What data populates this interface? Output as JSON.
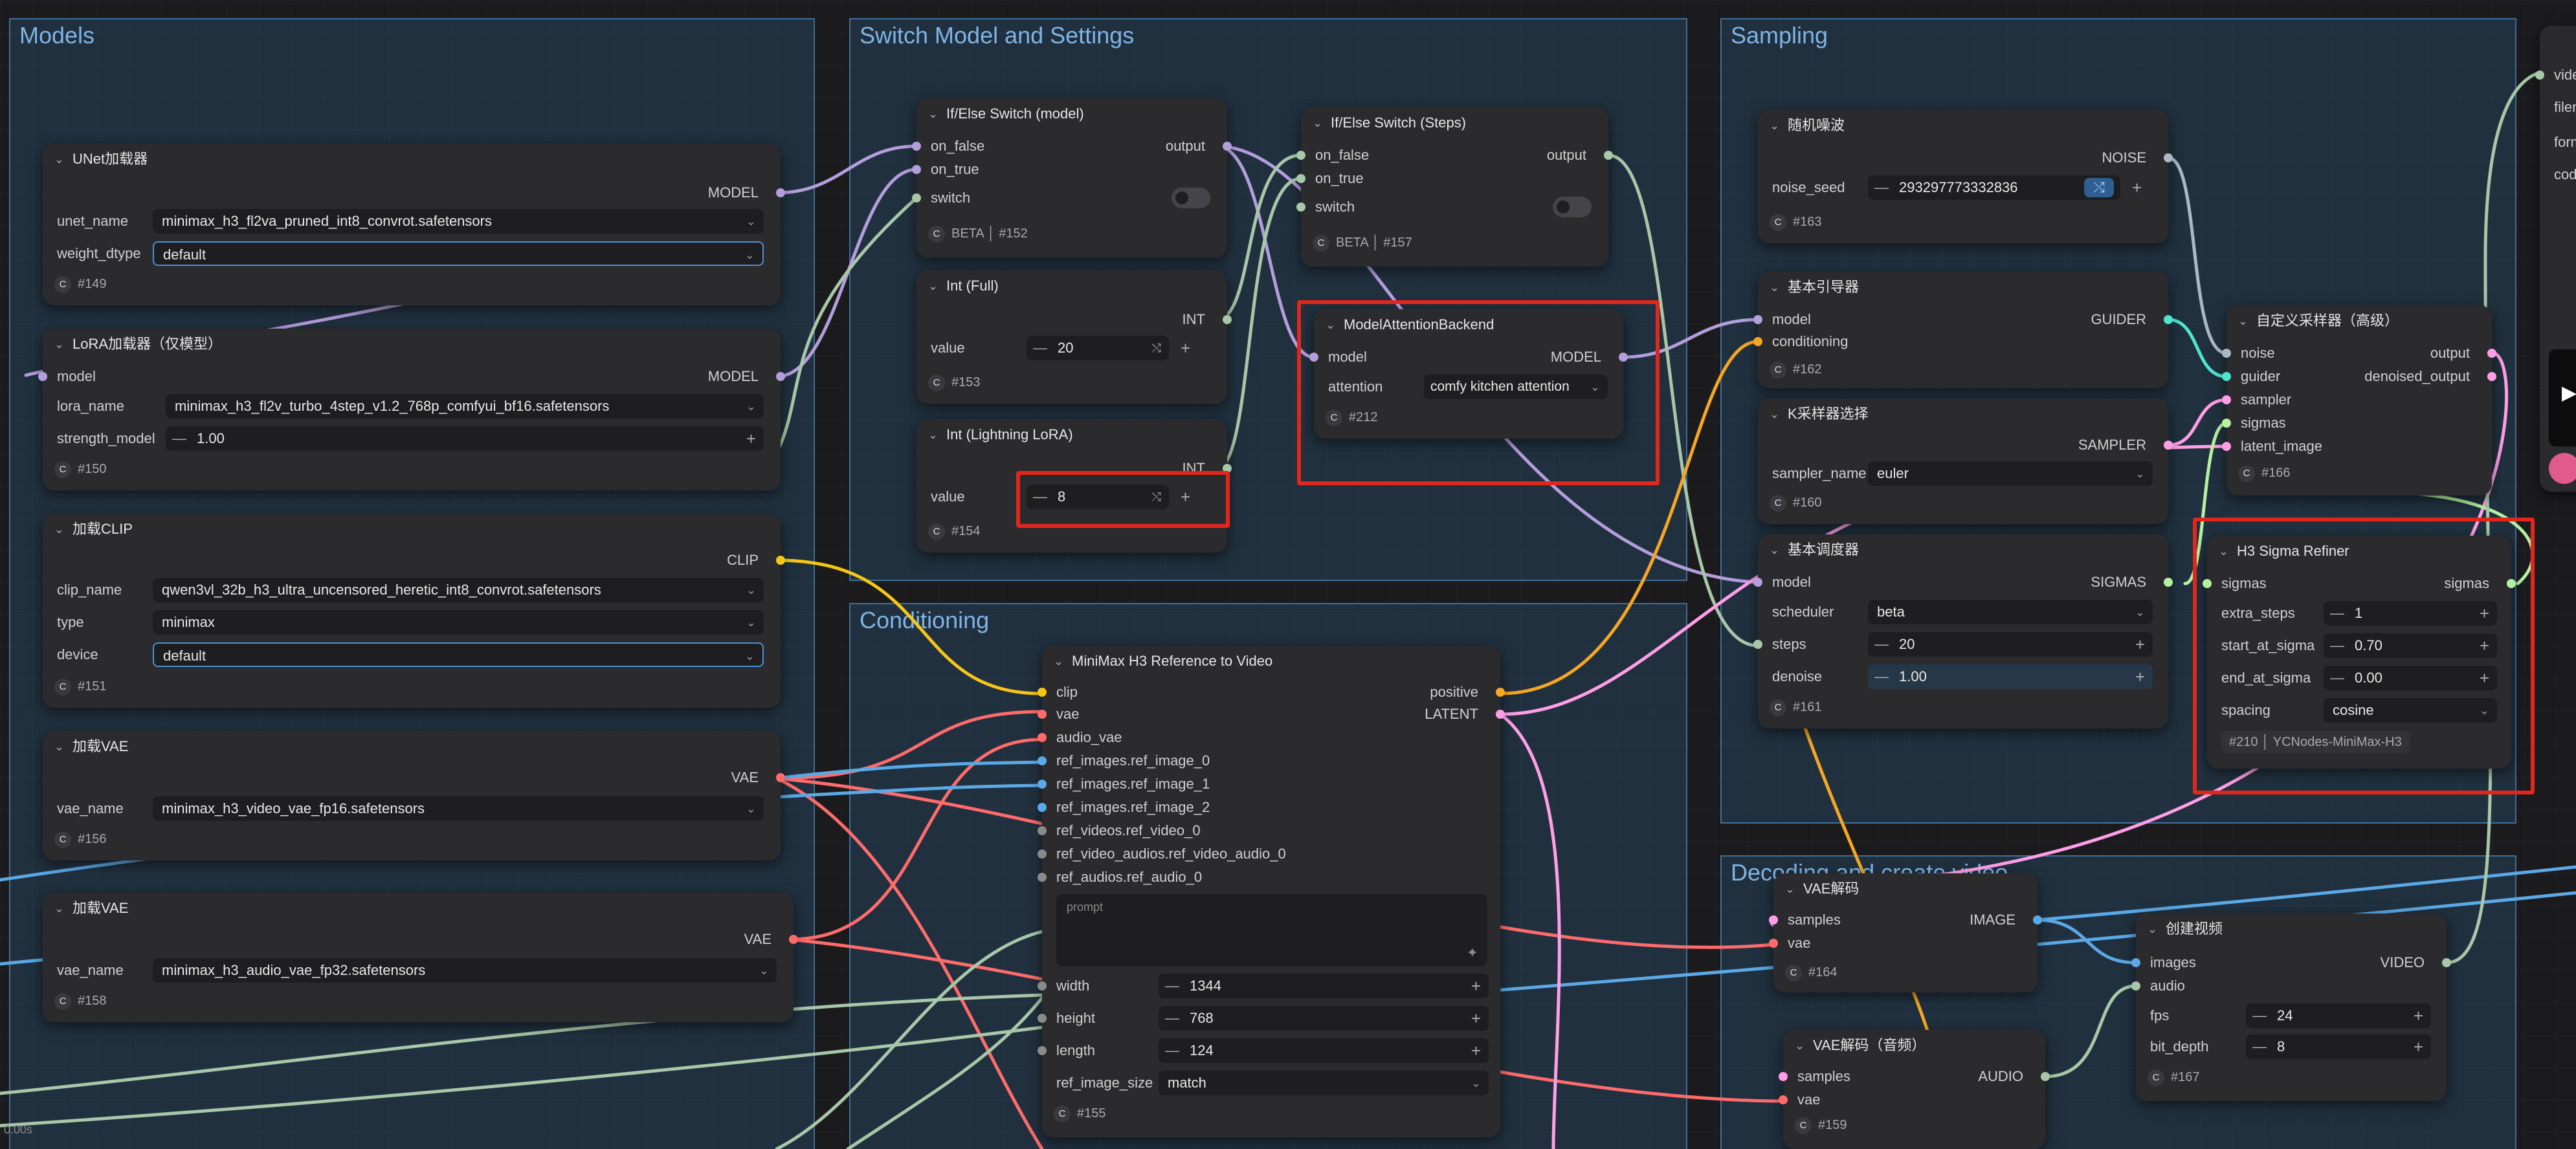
{
  "groups": {
    "models": "Models",
    "switch": "Switch Model and Settings",
    "sampling": "Sampling",
    "conditioning": "Conditioning",
    "decoding": "Decoding and create video"
  },
  "nodes": {
    "unet": {
      "title": "UNet加载器",
      "out": "MODEL",
      "unet_name_label": "unet_name",
      "unet_name": "minimax_h3_fl2va_pruned_int8_convrot.safetensors",
      "weight_dtype_label": "weight_dtype",
      "weight_dtype": "default",
      "id": "#149"
    },
    "lora": {
      "title": "LoRA加载器（仅模型）",
      "in_model": "model",
      "out": "MODEL",
      "lora_name_label": "lora_name",
      "lora_name": "minimax_h3_fl2v_turbo_4step_v1.2_768p_comfyui_bf16.safetensors",
      "strength_label": "strength_model",
      "strength": "1.00",
      "id": "#150"
    },
    "clip": {
      "title": "加载CLIP",
      "out": "CLIP",
      "clip_name_label": "clip_name",
      "clip_name": "qwen3vl_32b_h3_ultra_uncensored_heretic_int8_convrot.safetensors",
      "type_label": "type",
      "type": "minimax",
      "device_label": "device",
      "device": "default",
      "id": "#151"
    },
    "vae1": {
      "title": "加载VAE",
      "out": "VAE",
      "vae_name_label": "vae_name",
      "vae_name": "minimax_h3_video_vae_fp16.safetensors",
      "id": "#156"
    },
    "vae2": {
      "title": "加载VAE",
      "out": "VAE",
      "vae_name_label": "vae_name",
      "vae_name": "minimax_h3_audio_vae_fp32.safetensors",
      "id": "#158"
    },
    "ifelse_model": {
      "title": "If/Else Switch (model)",
      "in1": "on_false",
      "in2": "on_true",
      "in3": "switch",
      "out": "output",
      "badge": "BETA",
      "id": "#152"
    },
    "int_full": {
      "title": "Int (Full)",
      "out": "INT",
      "value_label": "value",
      "value": "20",
      "id": "#153"
    },
    "int_lora": {
      "title": "Int (Lightning LoRA)",
      "out": "INT",
      "value_label": "value",
      "value": "8",
      "id": "#154"
    },
    "ifelse_steps": {
      "title": "If/Else Switch (Steps)",
      "in1": "on_false",
      "in2": "on_true",
      "in3": "switch",
      "out": "output",
      "badge": "BETA",
      "id": "#157"
    },
    "attn": {
      "title": "ModelAttentionBackend",
      "in_model": "model",
      "out": "MODEL",
      "attention_label": "attention",
      "attention": "comfy kitchen attention",
      "id": "#212"
    },
    "ref2video": {
      "title": "MiniMax H3 Reference to Video",
      "inputs": [
        "clip",
        "vae",
        "audio_vae",
        "ref_images.ref_image_0",
        "ref_images.ref_image_1",
        "ref_images.ref_image_2",
        "ref_videos.ref_video_0",
        "ref_video_audios.ref_video_audio_0",
        "ref_audios.ref_audio_0"
      ],
      "out1": "positive",
      "out2": "LATENT",
      "prompt_placeholder": "prompt",
      "width_label": "width",
      "width": "1344",
      "height_label": "height",
      "height": "768",
      "length_label": "length",
      "length": "124",
      "ref_size_label": "ref_image_size",
      "ref_size": "match",
      "id": "#155"
    },
    "noise": {
      "title": "随机噪波",
      "out": "NOISE",
      "seed_label": "noise_seed",
      "seed": "293297773332836",
      "id": "#163"
    },
    "guider": {
      "title": "基本引导器",
      "in1": "model",
      "in2": "conditioning",
      "out": "GUIDER",
      "id": "#162"
    },
    "ksampler_select": {
      "title": "K采样器选择",
      "out": "SAMPLER",
      "sampler_label": "sampler_name",
      "sampler": "euler",
      "id": "#160"
    },
    "scheduler": {
      "title": "基本调度器",
      "in_model": "model",
      "out": "SIGMAS",
      "scheduler_label": "scheduler",
      "scheduler": "beta",
      "steps_label": "steps",
      "steps": "20",
      "denoise_label": "denoise",
      "denoise": "1.00",
      "id": "#161"
    },
    "custom_sampler": {
      "title": "自定义采样器（高级）",
      "inputs": [
        "noise",
        "guider",
        "sampler",
        "sigmas",
        "latent_image"
      ],
      "out1": "output",
      "out2": "denoised_output",
      "id": "#166"
    },
    "refiner": {
      "title": "H3 Sigma Refiner",
      "in": "sigmas",
      "out": "sigmas",
      "extra_label": "extra_steps",
      "extra": "1",
      "start_label": "start_at_sigma",
      "start": "0.70",
      "end_label": "end_at_sigma",
      "end": "0.00",
      "spacing_label": "spacing",
      "spacing": "cosine",
      "id": "#210",
      "pack": "YCNodes-MiniMax-H3"
    },
    "vae_decode": {
      "title": "VAE解码",
      "in1": "samples",
      "in2": "vae",
      "out": "IMAGE",
      "id": "#164"
    },
    "vae_decode_audio": {
      "title": "VAE解码（音频）",
      "in1": "samples",
      "in2": "vae",
      "out": "AUDIO",
      "id": "#159"
    },
    "create_video": {
      "title": "创建视频",
      "in1": "images",
      "in2": "audio",
      "out": "VIDEO",
      "fps_label": "fps",
      "fps": "24",
      "bit_label": "bit_depth",
      "bit": "8",
      "id": "#167"
    },
    "save": {
      "labels": [
        "video",
        "filen",
        "form",
        "code"
      ]
    }
  },
  "status": {
    "coords": "0.00s"
  },
  "colors": {
    "model": "#b39ddb",
    "clip": "#f5c518",
    "vae": "#ff6b6b",
    "latent": "#ff9ee6",
    "int": "#a8c7a8",
    "audio": "#5aa9e6",
    "noise": "#aab8c8",
    "guider": "#4fe3d0",
    "sigmas": "#b4f0a0",
    "highlight": "#e1261c",
    "group": "#3f6f98"
  }
}
